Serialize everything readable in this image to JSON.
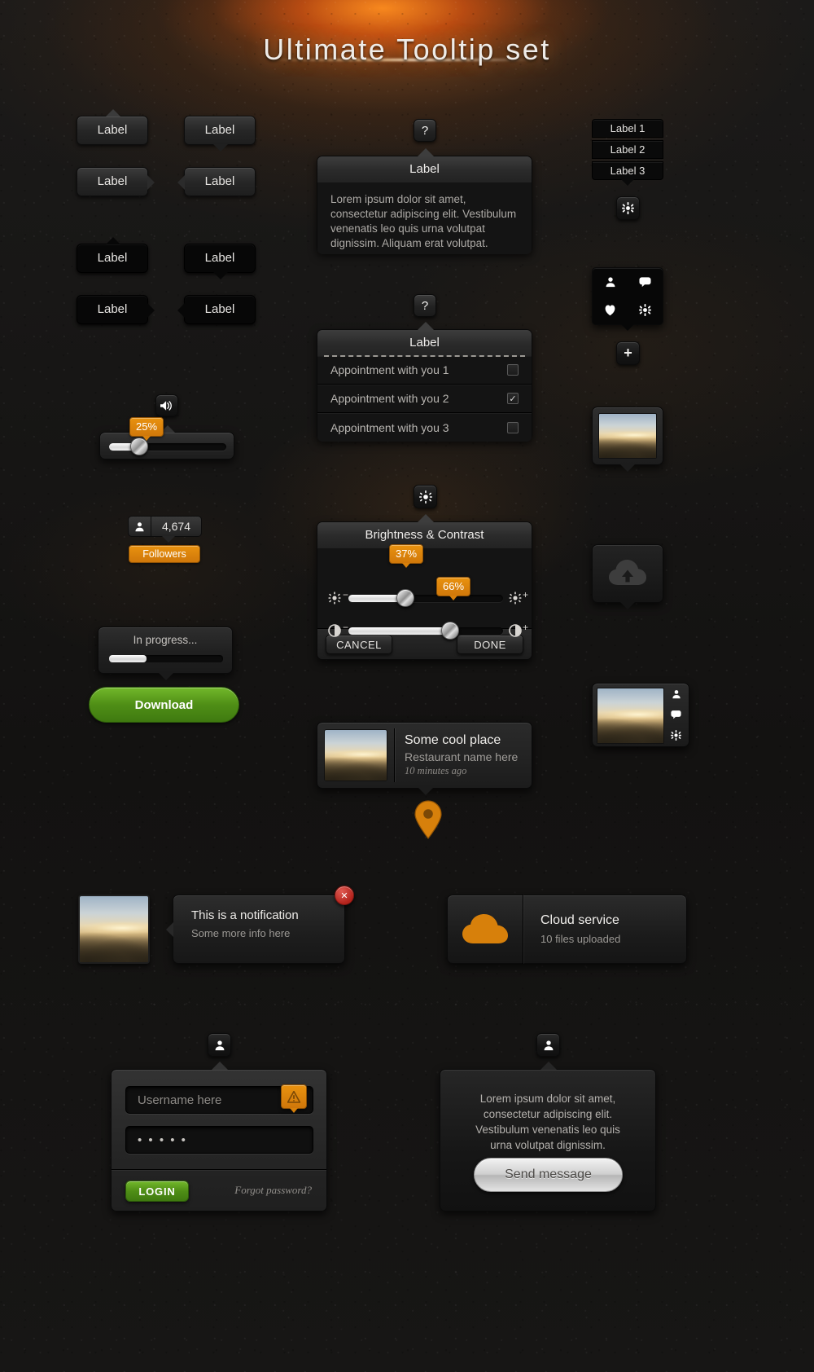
{
  "title": "Ultimate Tooltip set",
  "labels": {
    "simple": "Label",
    "panel_title": "Label",
    "lorem": "Lorem ipsum dolor sit amet, consectetur adipiscing elit. Vestibulum venenatis leo quis urna volutpat dignissim. Aliquam erat volutpat."
  },
  "label_tooltips": [
    {
      "text": "Label",
      "style": "grey",
      "arrow": "top"
    },
    {
      "text": "Label",
      "style": "grey",
      "arrow": "bottom"
    },
    {
      "text": "Label",
      "style": "grey",
      "arrow": "right"
    },
    {
      "text": "Label",
      "style": "grey",
      "arrow": "left"
    },
    {
      "text": "Label",
      "style": "black",
      "arrow": "top"
    },
    {
      "text": "Label",
      "style": "black",
      "arrow": "bottom"
    },
    {
      "text": "Label",
      "style": "black",
      "arrow": "right"
    },
    {
      "text": "Label",
      "style": "black",
      "arrow": "left"
    }
  ],
  "help_icon": "?",
  "appointments": {
    "title": "Label",
    "items": [
      {
        "label": "Appointment with you 1",
        "checked": false
      },
      {
        "label": "Appointment with you 2",
        "checked": true
      },
      {
        "label": "Appointment with you 3",
        "checked": false
      }
    ]
  },
  "label_stack": {
    "items": [
      "Label 1",
      "Label 2",
      "Label 3"
    ],
    "icon": "gear-icon"
  },
  "icon_grid": {
    "icons": [
      "user-icon",
      "comment-icon",
      "heart-icon",
      "gear-icon"
    ],
    "plus": "+"
  },
  "volume": {
    "icon": "speaker-icon",
    "value": "25%",
    "percent": 25
  },
  "followers": {
    "icon": "user-icon",
    "count": "4,674",
    "label": "Followers"
  },
  "progress": {
    "text": "In progress...",
    "percent": 33,
    "button": "Download"
  },
  "brightness": {
    "icon": "brightness-icon",
    "title": "Brightness & Contrast",
    "sliders": [
      {
        "name": "brightness",
        "value": "37%",
        "percent": 37,
        "left_icon": "brightness-minus-icon",
        "right_icon": "brightness-plus-icon"
      },
      {
        "name": "contrast",
        "value": "66%",
        "percent": 66,
        "left_icon": "contrast-minus-icon",
        "right_icon": "contrast-plus-icon"
      }
    ],
    "cancel": "CANCEL",
    "done": "DONE"
  },
  "place_card": {
    "title": "Some cool place",
    "subtitle": "Restaurant name here",
    "time": "10 minutes ago"
  },
  "map_pin": "map-pin-icon",
  "notification": {
    "title": "This is a notification",
    "subtitle": "Some more info here",
    "close": "✕"
  },
  "cloud": {
    "icon": "cloud-icon",
    "title": "Cloud service",
    "subtitle": "10 files uploaded"
  },
  "photo_tooltip": {
    "icon": "photo-icon"
  },
  "cloud_upload_tooltip": {
    "icon": "cloud-upload-icon"
  },
  "photo_actions": {
    "icons": [
      "user-icon",
      "comment-icon",
      "gear-icon"
    ]
  },
  "login": {
    "icon": "user-icon",
    "username_placeholder": "Username here",
    "password_value": "• • • • •",
    "warning_icon": "warning-icon",
    "submit": "LOGIN",
    "forgot": "Forgot password?"
  },
  "message": {
    "icon": "user-icon",
    "body": "Lorem ipsum dolor sit amet, consectetur adipiscing elit. Vestibulum venenatis leo quis urna volutpat dignissim.",
    "button": "Send message"
  },
  "colors": {
    "accent": "#d7800b",
    "green": "#4f8e16",
    "panel": "#141414",
    "text": "#e7e5e2"
  }
}
